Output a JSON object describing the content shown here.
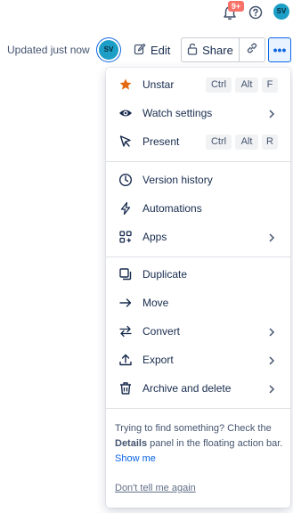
{
  "header": {
    "notifications_badge": "9+",
    "avatar_initials": "SV"
  },
  "toolbar": {
    "updated_text": "Updated just now",
    "avatar_initials": "SV",
    "edit_label": "Edit",
    "share_label": "Share",
    "more_label": "•••"
  },
  "menu": {
    "unstar": {
      "label": "Unstar",
      "keys": [
        "Ctrl",
        "Alt",
        "F"
      ]
    },
    "watch_settings": {
      "label": "Watch settings"
    },
    "present": {
      "label": "Present",
      "keys": [
        "Ctrl",
        "Alt",
        "R"
      ]
    },
    "version_history": {
      "label": "Version history"
    },
    "automations": {
      "label": "Automations"
    },
    "apps": {
      "label": "Apps"
    },
    "duplicate": {
      "label": "Duplicate"
    },
    "move": {
      "label": "Move"
    },
    "convert": {
      "label": "Convert"
    },
    "export": {
      "label": "Export"
    },
    "archive_delete": {
      "label": "Archive and delete"
    }
  },
  "hint": {
    "text_before": "Trying to find something? Check the ",
    "details": "Details",
    "text_after": " panel in the floating action bar.",
    "show_me": "Show me",
    "dont_tell": "Don't tell me again"
  },
  "colors": {
    "accent": "#0c66e4",
    "star": "#e56910",
    "badge": "#f87168",
    "avatar": "#1d9ec6"
  }
}
